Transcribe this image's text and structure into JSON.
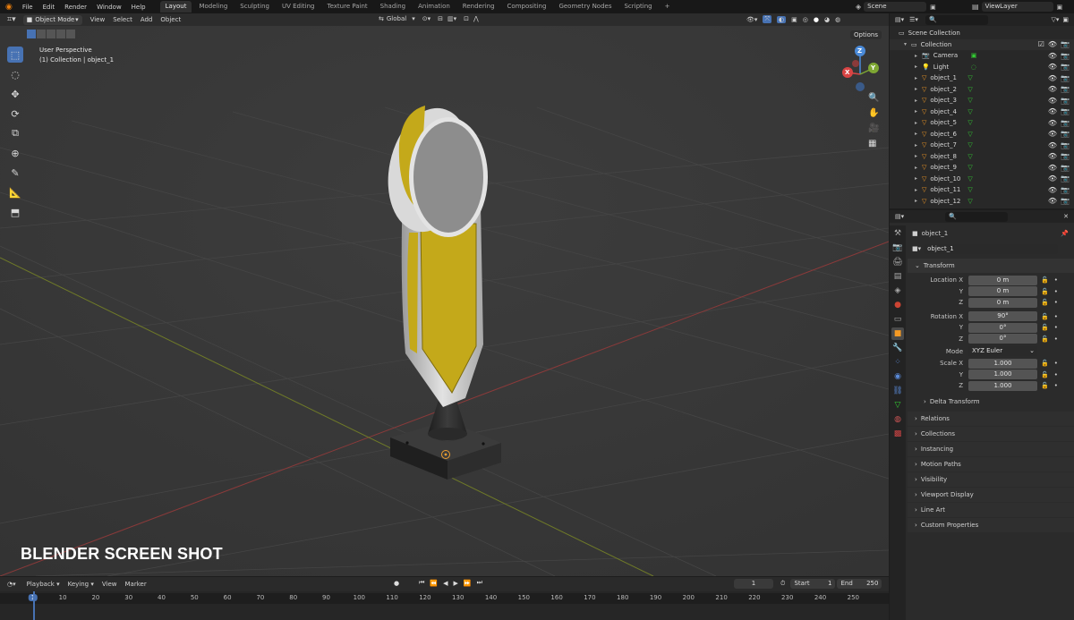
{
  "topbar": {
    "menus": [
      "File",
      "Edit",
      "Render",
      "Window",
      "Help"
    ],
    "workspaces": [
      "Layout",
      "Modeling",
      "Sculpting",
      "UV Editing",
      "Texture Paint",
      "Shading",
      "Animation",
      "Rendering",
      "Compositing",
      "Geometry Nodes",
      "Scripting"
    ],
    "add_tab": "+",
    "scene": "Scene",
    "view_layer": "ViewLayer"
  },
  "viewport_header": {
    "mode": "Object Mode",
    "menus": [
      "View",
      "Select",
      "Add",
      "Object"
    ],
    "orientation": "Global",
    "options": "Options"
  },
  "viewport": {
    "view_name": "User Perspective",
    "collection_info": "(1) Collection | object_1",
    "watermark": "BLENDER SCREEN SHOT",
    "gizmo": {
      "x": "X",
      "y": "Y",
      "z": "Z"
    }
  },
  "outliner": {
    "root": "Scene Collection",
    "collection": "Collection",
    "items": [
      "Camera",
      "Light",
      "object_1",
      "object_2",
      "object_3",
      "object_4",
      "object_5",
      "object_6",
      "object_7",
      "object_8",
      "object_9",
      "object_10",
      "object_11",
      "object_12"
    ]
  },
  "properties": {
    "object_name": "object_1",
    "datablock": "object_1",
    "transform_title": "Transform",
    "location_label": "Location X",
    "location": [
      "0 m",
      "0 m",
      "0 m"
    ],
    "rotation_label": "Rotation X",
    "rotation": [
      "90°",
      "0°",
      "0°"
    ],
    "mode_label": "Mode",
    "mode_value": "XYZ Euler",
    "scale_label": "Scale X",
    "scale": [
      "1.000",
      "1.000",
      "1.000"
    ],
    "axis_y": "Y",
    "axis_z": "Z",
    "delta_transform": "Delta Transform",
    "panels": [
      "Relations",
      "Collections",
      "Instancing",
      "Motion Paths",
      "Visibility",
      "Viewport Display",
      "Line Art",
      "Custom Properties"
    ]
  },
  "timeline": {
    "menus": [
      "Playback",
      "Keying",
      "View",
      "Marker"
    ],
    "current_frame": "1",
    "start_label": "Start",
    "start": "1",
    "end_label": "End",
    "end": "250",
    "ruler": [
      "1",
      "10",
      "20",
      "30",
      "40",
      "50",
      "60",
      "70",
      "80",
      "90",
      "100",
      "110",
      "120",
      "130",
      "140",
      "150",
      "160",
      "170",
      "180",
      "190",
      "200",
      "210",
      "220",
      "230",
      "240",
      "250"
    ]
  },
  "colors": {
    "accent": "#4772b3",
    "object_yellow": "#c4a91a",
    "grid_line": "#424242",
    "x_axis": "#8a3a3a",
    "y_axis": "#6f7a28"
  }
}
